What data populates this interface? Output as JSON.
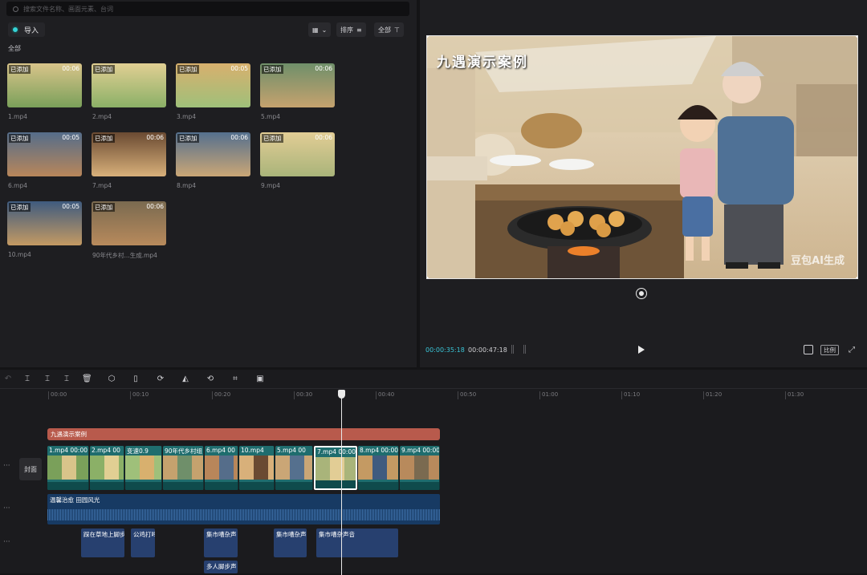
{
  "media": {
    "search_placeholder": "搜索文件名称、画面元素、台词",
    "import_label": "导入",
    "sort_label": "排序",
    "filter_label": "全部",
    "section_label": "全部",
    "items": [
      {
        "tag": "已添加",
        "duration": "00:06",
        "name": "1.mp4",
        "colors": [
          "#7aa05a",
          "#d9c48a"
        ]
      },
      {
        "tag": "已添加",
        "duration": "",
        "name": "2.mp4",
        "colors": [
          "#8bb067",
          "#e1cf93"
        ]
      },
      {
        "tag": "已添加",
        "duration": "00:05",
        "name": "3.mp4",
        "colors": [
          "#9fc07a",
          "#d8b06e"
        ]
      },
      {
        "tag": "已添加",
        "duration": "00:06",
        "name": "5.mp4",
        "colors": [
          "#c5a26e",
          "#6f8f6a"
        ]
      },
      {
        "tag": "已添加",
        "duration": "00:05",
        "name": "6.mp4",
        "colors": [
          "#b8865a",
          "#556d8a"
        ]
      },
      {
        "tag": "已添加",
        "duration": "00:06",
        "name": "7.mp4",
        "colors": [
          "#d8b07a",
          "#6a4a32"
        ]
      },
      {
        "tag": "已添加",
        "duration": "00:06",
        "name": "8.mp4",
        "colors": [
          "#caa676",
          "#55708e"
        ]
      },
      {
        "tag": "已添加",
        "duration": "00:06",
        "name": "9.mp4",
        "colors": [
          "#a9b47a",
          "#e2cd95"
        ]
      },
      {
        "tag": "已添加",
        "duration": "00:05",
        "name": "10.mp4",
        "colors": [
          "#c49a63",
          "#3f5b7f"
        ]
      },
      {
        "tag": "已添加",
        "duration": "00:06",
        "name": "90年代乡村...生成.mp4",
        "colors": [
          "#b88a5c",
          "#7a6a50"
        ]
      }
    ]
  },
  "preview": {
    "title": "九遇演示案例",
    "watermark": "豆包AI生成",
    "current_time": "00:00:35:18",
    "total_time": "00:00:47:18",
    "ratio_label": "比例"
  },
  "timeline": {
    "ticks": [
      "00:00",
      "00:10",
      "00:20",
      "00:30",
      "00:40",
      "00:50",
      "01:00",
      "01:10",
      "01:20",
      "01:30"
    ],
    "cover_label": "封面",
    "text_clip": "九遇演示案例",
    "video_clips": [
      {
        "label": "1.mp4  00:00"
      },
      {
        "label": "2.mp4  00"
      },
      {
        "label": "变速0.9"
      },
      {
        "label": "90年代乡村组"
      },
      {
        "label": "6.mp4  00"
      },
      {
        "label": "10.mp4"
      },
      {
        "label": "5.mp4  00"
      },
      {
        "label": "7.mp4  00:00"
      },
      {
        "label": "8.mp4  00:00"
      },
      {
        "label": "9.mp4  00:00"
      }
    ],
    "audio_main": "温馨治愈 田园风光",
    "sfx": [
      {
        "label": "踩在草地上脚步"
      },
      {
        "label": "公鸡打鸣"
      },
      {
        "label": "集市嘈杂声"
      },
      {
        "label": "集市嘈杂声"
      },
      {
        "label": "集市嘈杂声音"
      },
      {
        "label": "多人脚步声"
      }
    ]
  },
  "colors": {
    "accent": "#35d3d6",
    "text_track": "#b85a4c",
    "video_track": "#1f6d6e",
    "audio_track": "#173a63"
  }
}
